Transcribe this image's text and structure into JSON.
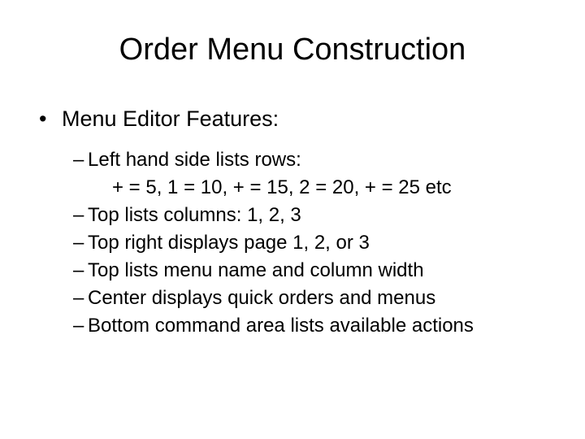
{
  "title": "Order Menu Construction",
  "level1": {
    "bullet": "•",
    "text": "Menu Editor Features:"
  },
  "items": [
    {
      "dash": "–",
      "text": "Left hand side lists rows:"
    },
    {
      "indent": true,
      "text": "+ = 5, 1 = 10, + = 15, 2 = 20, + = 25 etc"
    },
    {
      "dash": "–",
      "text": "Top lists columns: 1, 2, 3"
    },
    {
      "dash": "–",
      "text": "Top right displays page 1, 2, or 3"
    },
    {
      "dash": "–",
      "text": "Top lists menu name and column width"
    },
    {
      "dash": "–",
      "text": "Center displays quick orders and menus"
    },
    {
      "dash": "–",
      "text": "Bottom command area lists available actions"
    }
  ]
}
